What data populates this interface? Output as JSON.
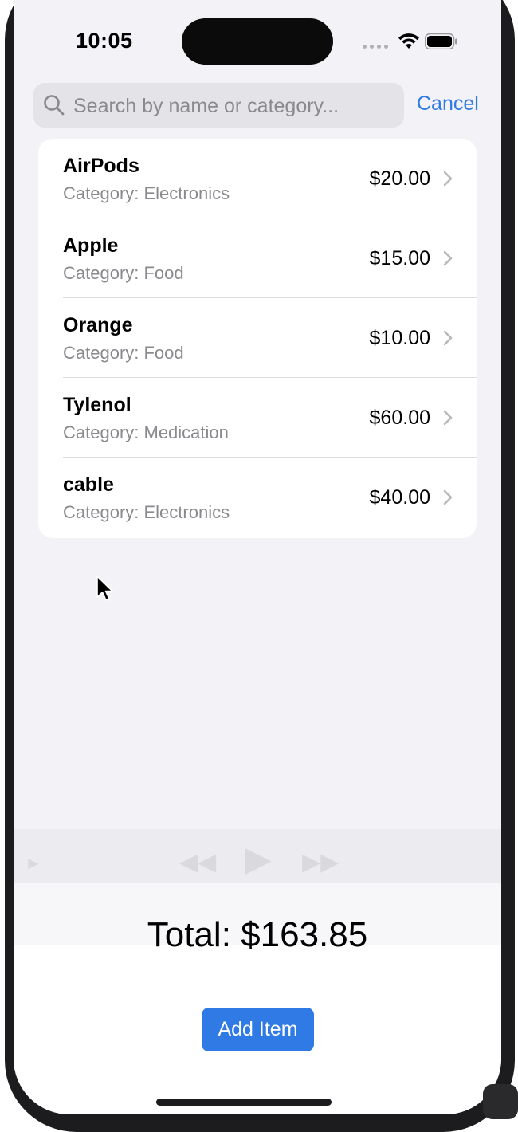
{
  "status_bar": {
    "time": "10:05"
  },
  "search": {
    "placeholder": "Search by name or category...",
    "value": "",
    "cancel_label": "Cancel"
  },
  "items": [
    {
      "name": "AirPods",
      "category": "Category: Electronics",
      "price": "$20.00"
    },
    {
      "name": "Apple",
      "category": "Category: Food",
      "price": "$15.00"
    },
    {
      "name": "Orange",
      "category": "Category: Food",
      "price": "$10.00"
    },
    {
      "name": "Tylenol",
      "category": "Category: Medication",
      "price": "$60.00"
    },
    {
      "name": "cable",
      "category": "Category: Electronics",
      "price": "$40.00"
    }
  ],
  "footer": {
    "total": "Total: $163.85",
    "add_button_label": "Add Item"
  },
  "colors": {
    "accent": "#2f7ae5",
    "background": "#f2f2f7",
    "card": "#ffffff",
    "secondary_text": "#8a8a8e"
  }
}
